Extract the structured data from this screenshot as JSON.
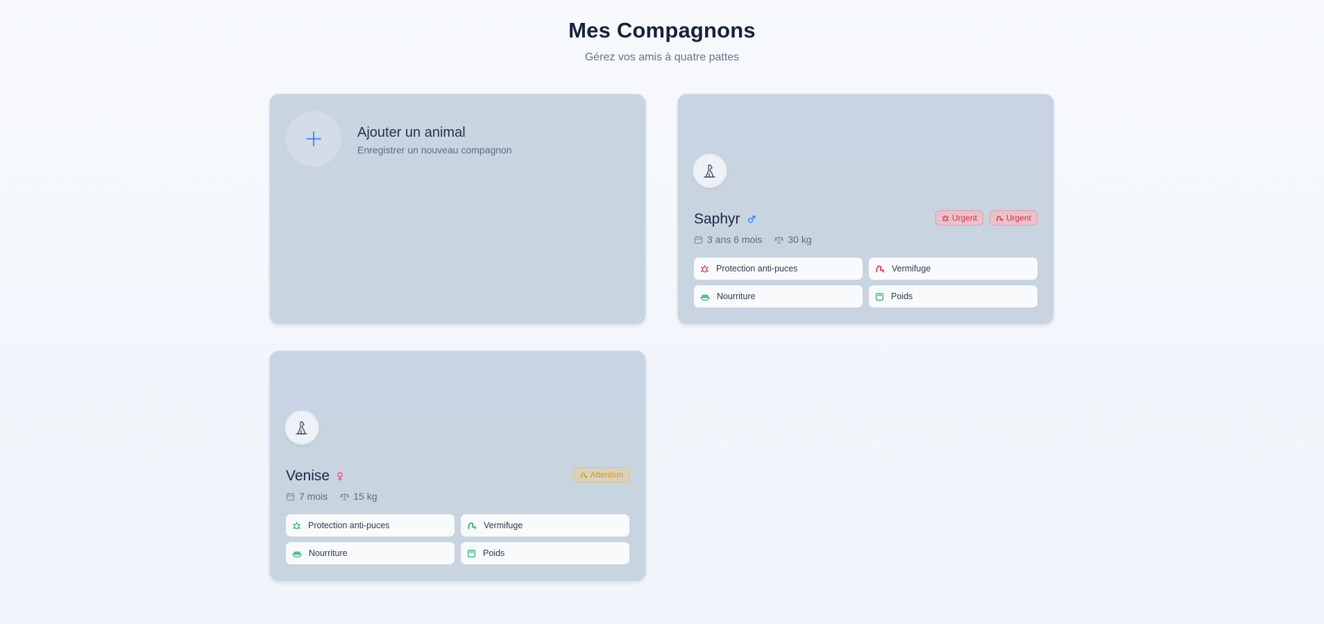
{
  "header": {
    "title": "Mes Compagnons",
    "subtitle": "Gérez vos amis à quatre pattes"
  },
  "add_card": {
    "title": "Ajouter un animal",
    "subtitle": "Enregistrer un nouveau compagnon",
    "icon": "plus-icon"
  },
  "pets": [
    {
      "name": "Saphyr",
      "sex": "male",
      "sex_symbol": "♂",
      "age": "3 ans 6 mois",
      "weight": "30 kg",
      "badges": [
        {
          "label": "Urgent",
          "icon": "flea-icon",
          "level": "urgent"
        },
        {
          "label": "Urgent",
          "icon": "worm-icon",
          "level": "urgent"
        }
      ],
      "care": [
        {
          "label": "Protection anti-puces",
          "icon": "flea-icon",
          "status_color": "#e2364d"
        },
        {
          "label": "Vermifuge",
          "icon": "worm-icon",
          "status_color": "#e2364d"
        },
        {
          "label": "Nourriture",
          "icon": "food-bowl-icon",
          "status_color": "#22b573"
        },
        {
          "label": "Poids",
          "icon": "scale-icon",
          "status_color": "#22b573"
        }
      ]
    },
    {
      "name": "Venise",
      "sex": "female",
      "sex_symbol": "♀",
      "age": "7 mois",
      "weight": "15 kg",
      "badges": [
        {
          "label": "Attention",
          "icon": "worm-icon",
          "level": "attention"
        }
      ],
      "care": [
        {
          "label": "Protection anti-puces",
          "icon": "flea-icon",
          "status_color": "#22b573"
        },
        {
          "label": "Vermifuge",
          "icon": "worm-icon",
          "status_color": "#22b573"
        },
        {
          "label": "Nourriture",
          "icon": "food-bowl-icon",
          "status_color": "#22b573"
        },
        {
          "label": "Poids",
          "icon": "scale-icon",
          "status_color": "#22b573"
        }
      ]
    }
  ],
  "colors": {
    "urgent": "#dc2f45",
    "attention": "#d89c0e",
    "ok": "#22b573",
    "male": "#3b82f6",
    "female": "#ec4899",
    "accent": "#3b82f6"
  }
}
